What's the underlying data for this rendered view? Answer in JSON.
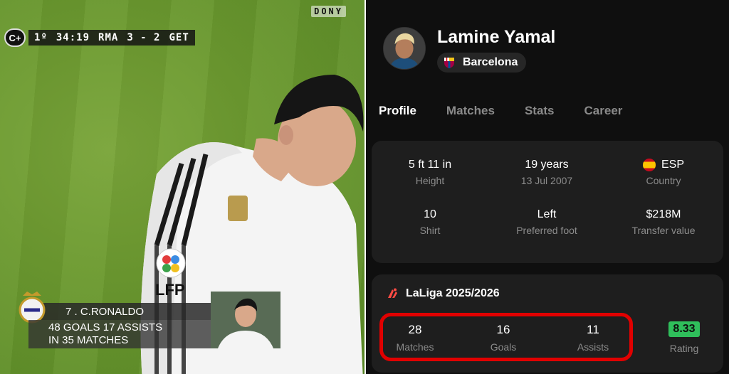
{
  "broadcast": {
    "watermark": "DONY",
    "channel_logo": "C+",
    "scorebug": {
      "period": "1º",
      "clock": "34:19",
      "home": "RMA",
      "score": "3 - 2",
      "away": "GET"
    },
    "caption": {
      "player": "7 . C.RONALDO",
      "line1": "48 GOALS 17 ASSISTS",
      "line2": "IN 35 MATCHES"
    },
    "shirt_text": "LFP"
  },
  "profile": {
    "name": "Lamine Yamal",
    "club": "Barcelona",
    "tabs": [
      {
        "label": "Profile",
        "active": true
      },
      {
        "label": "Matches",
        "active": false
      },
      {
        "label": "Stats",
        "active": false
      },
      {
        "label": "Career",
        "active": false
      }
    ],
    "info": {
      "height": {
        "value": "5 ft 11 in",
        "label": "Height"
      },
      "age": {
        "value": "19 years",
        "label": "13 Jul 2007"
      },
      "country": {
        "value": "ESP",
        "label": "Country"
      },
      "shirt": {
        "value": "10",
        "label": "Shirt"
      },
      "foot": {
        "value": "Left",
        "label": "Preferred foot"
      },
      "transfer": {
        "value": "$218M",
        "label": "Transfer value"
      }
    },
    "league": {
      "title": "LaLiga 2025/2026",
      "matches": {
        "value": "28",
        "label": "Matches"
      },
      "goals": {
        "value": "16",
        "label": "Goals"
      },
      "assists": {
        "value": "11",
        "label": "Assists"
      },
      "rating": {
        "value": "8.33",
        "label": "Rating"
      }
    }
  },
  "colors": {
    "app_bg": "#0f0f0f",
    "card_bg": "#1e1e1e",
    "highlight_ring": "#e10000",
    "rating_badge": "#2fbf5b",
    "pitch": "#6c9a30"
  }
}
